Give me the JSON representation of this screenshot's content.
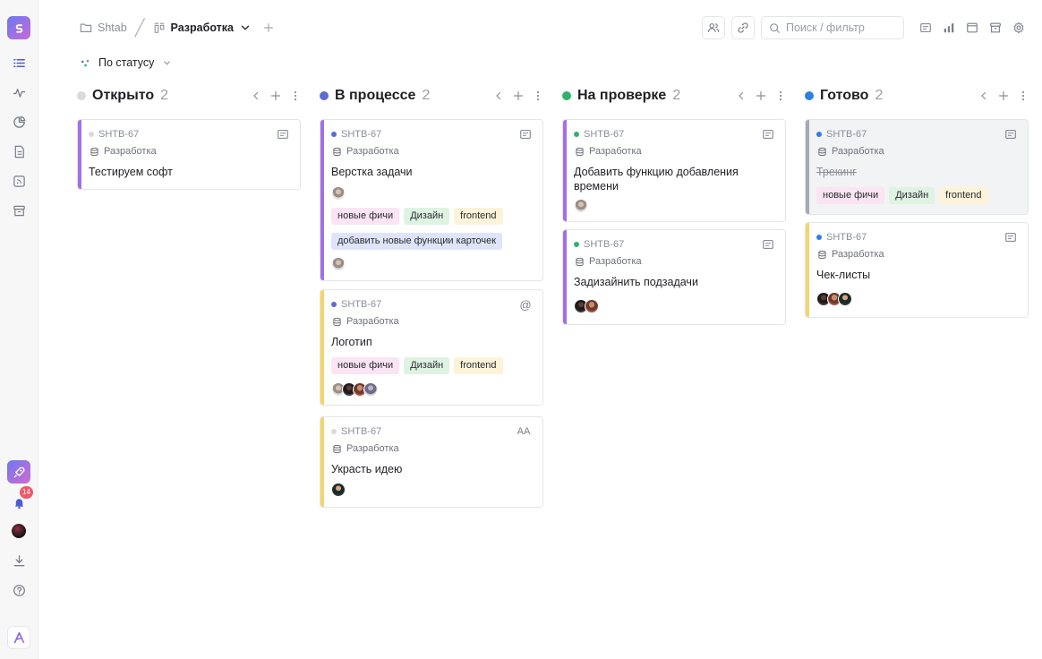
{
  "breadcrumbs": {
    "workspace": "Shtab",
    "project": "Разработка"
  },
  "toolbar": {
    "search_placeholder": "Поиск / фильтр"
  },
  "group_by": {
    "label": "По статусу"
  },
  "rail": {
    "notifications_count": "14"
  },
  "colors": {
    "open": "#d8dadd",
    "progress": "#5b6bd8",
    "review": "#2fb36b",
    "done": "#2f80e4",
    "purple_bar": "#a46fe6",
    "yellow_bar": "#f5d46a",
    "grey_bar": "#a6a9af"
  },
  "columns": [
    {
      "title": "Открыто",
      "count": "2",
      "cards": [
        {
          "id": "SHTB-67",
          "project": "Разработка",
          "title": "Тестируем софт",
          "corner_icon": "description-icon"
        }
      ]
    },
    {
      "title": "В процессе",
      "count": "2",
      "cards": [
        {
          "id": "SHTB-67",
          "project": "Разработка",
          "title": "Верстка задачи",
          "corner_icon": "description-icon",
          "tags": [
            "новые фичи",
            "Дизайн",
            "frontend"
          ],
          "tags2": [
            "добавить новые функции карточек"
          ]
        },
        {
          "id": "SHTB-67",
          "project": "Разработка",
          "title": "Логотип",
          "corner_icon": "mention-icon",
          "corner_text": "@",
          "tags": [
            "новые фичи",
            "Дизайн",
            "frontend"
          ]
        },
        {
          "id": "SHTB-67",
          "project": "Разработка",
          "title": "Украсть идею",
          "corner_icon": "text-size-icon",
          "corner_text": "AA"
        }
      ]
    },
    {
      "title": "На проверке",
      "count": "2",
      "cards": [
        {
          "id": "SHTB-67",
          "project": "Разработка",
          "title": "Добавить функцию добавления времени",
          "corner_icon": "description-icon"
        },
        {
          "id": "SHTB-67",
          "project": "Разработка",
          "title": "Задизайнить подзадачи",
          "corner_icon": "description-icon"
        }
      ]
    },
    {
      "title": "Готово",
      "count": "2",
      "cards": [
        {
          "id": "SHTB-67",
          "project": "Разработка",
          "title": "Трекинг",
          "corner_icon": "description-icon",
          "tags": [
            "новые фичи",
            "Дизайн",
            "frontend"
          ]
        },
        {
          "id": "SHTB-67",
          "project": "Разработка",
          "title": "Чек-листы",
          "corner_icon": "description-icon"
        }
      ]
    }
  ]
}
